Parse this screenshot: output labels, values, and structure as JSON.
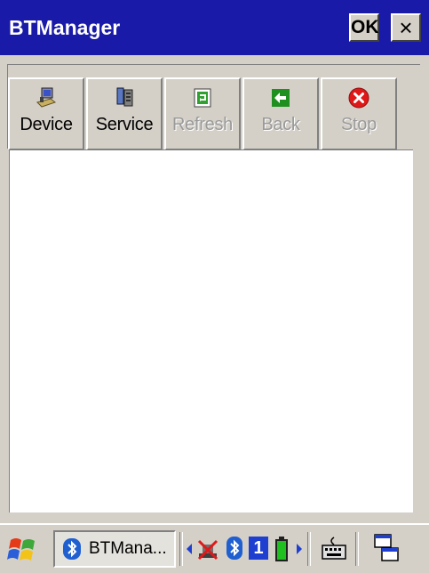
{
  "window": {
    "title": "BTManager",
    "ok_label": "OK",
    "close_label": "×"
  },
  "toolbar": {
    "buttons": [
      {
        "label": "Device",
        "icon": "device-computer-icon",
        "enabled": true
      },
      {
        "label": "Service",
        "icon": "service-server-icon",
        "enabled": true
      },
      {
        "label": "Refresh",
        "icon": "refresh-icon",
        "enabled": false
      },
      {
        "label": "Back",
        "icon": "back-arrow-icon",
        "enabled": false
      },
      {
        "label": "Stop",
        "icon": "stop-icon",
        "enabled": false
      }
    ]
  },
  "taskbar": {
    "start_icon": "windows-flag-icon",
    "task_label": "BTMana...",
    "task_icon": "bluetooth-icon",
    "tray": {
      "left_arrow": "left-arrow-icon",
      "network_icon": "network-disconnected-icon",
      "bluetooth_icon": "bluetooth-icon",
      "input_indicator": "1",
      "battery_icon": "battery-icon",
      "right_arrow": "right-arrow-icon",
      "keyboard_icon": "keyboard-icon",
      "desktop_icon": "switch-windows-icon"
    }
  },
  "colors": {
    "titlebar": "#1a1aa8",
    "face": "#d4d0c8",
    "stop": "#e01818",
    "back": "#1f8f1f"
  }
}
